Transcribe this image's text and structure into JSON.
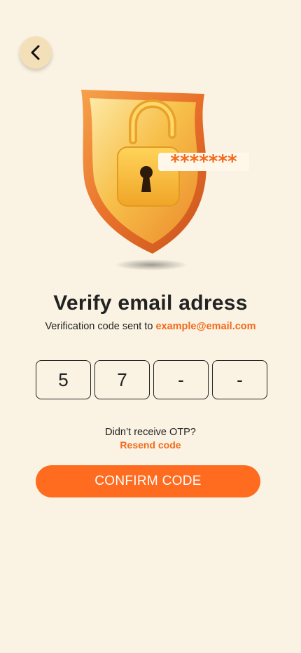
{
  "header": {
    "back_icon": "chevron-left-icon"
  },
  "illustration": {
    "icon": "shield-padlock-icon",
    "password_mask": "*******"
  },
  "main": {
    "title": "Verify email adress",
    "subtitle_prefix": "Verification code sent to ",
    "email": "example@email.com"
  },
  "otp": {
    "digits": [
      "5",
      "7",
      "-",
      "-"
    ]
  },
  "resend": {
    "question": "Didn’t receive OTP?",
    "link": "Resend code"
  },
  "confirm": {
    "label": "CONFIRM CODE"
  },
  "colors": {
    "background": "#faf2e2",
    "accent": "#ff6b1f",
    "accent_text": "#f26a1b",
    "back_button": "#f3e0b8"
  }
}
